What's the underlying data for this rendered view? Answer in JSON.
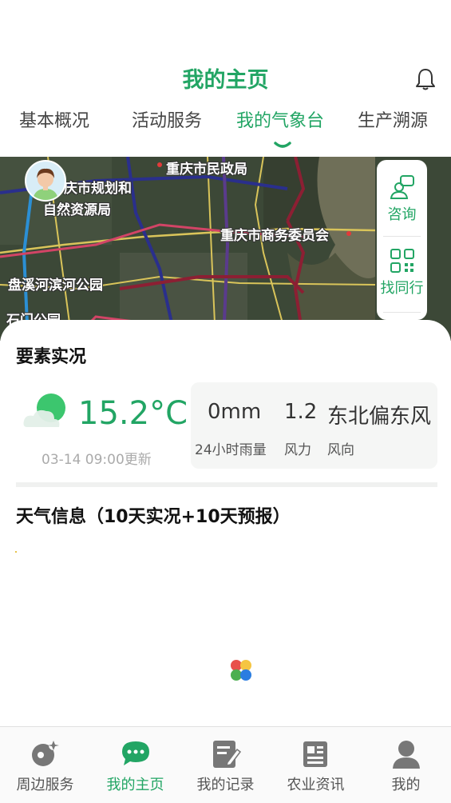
{
  "header": {
    "title": "我的主页",
    "bell_icon": "bell-icon"
  },
  "tabs": [
    {
      "label": "基本概况",
      "active": false
    },
    {
      "label": "活动服务",
      "active": false
    },
    {
      "label": "我的气象台",
      "active": true
    },
    {
      "label": "生产溯源",
      "active": false
    }
  ],
  "map": {
    "labels": [
      "重庆市民政局",
      "庆市规划和",
      "自然资源局",
      "重庆市商务委员会",
      "盘溪河滨河公园",
      "石门公园"
    ],
    "avatar_icon": "avatar-icon"
  },
  "side_panel": {
    "items": [
      {
        "label": "咨询",
        "icon": "consult-icon"
      },
      {
        "label": "找同行",
        "icon": "qr-code-icon"
      }
    ]
  },
  "weather_now": {
    "title": "要素实况",
    "temperature": "15.2°C",
    "updated": "03-14 09:00更新",
    "condition_icon": "partly-cloudy-icon",
    "stats": [
      {
        "value": "0mm",
        "label": "24小时雨量"
      },
      {
        "value": "1.2",
        "label": "风力"
      },
      {
        "value": "东北偏东风",
        "label": "风向"
      }
    ]
  },
  "forecast": {
    "title": "天气信息（10天实况+10天预报）"
  },
  "bottom_nav": [
    {
      "label": "周边服务",
      "icon": "nearby-service-icon",
      "active": false
    },
    {
      "label": "我的主页",
      "icon": "chat-bubble-icon",
      "active": true
    },
    {
      "label": "我的记录",
      "icon": "record-edit-icon",
      "active": false
    },
    {
      "label": "农业资讯",
      "icon": "news-icon",
      "active": false
    },
    {
      "label": "我的",
      "icon": "profile-icon",
      "active": false
    }
  ],
  "colors": {
    "accent": "#22a564",
    "muted_text": "#aaaaaa",
    "map_bg": "#3e4a3b"
  }
}
